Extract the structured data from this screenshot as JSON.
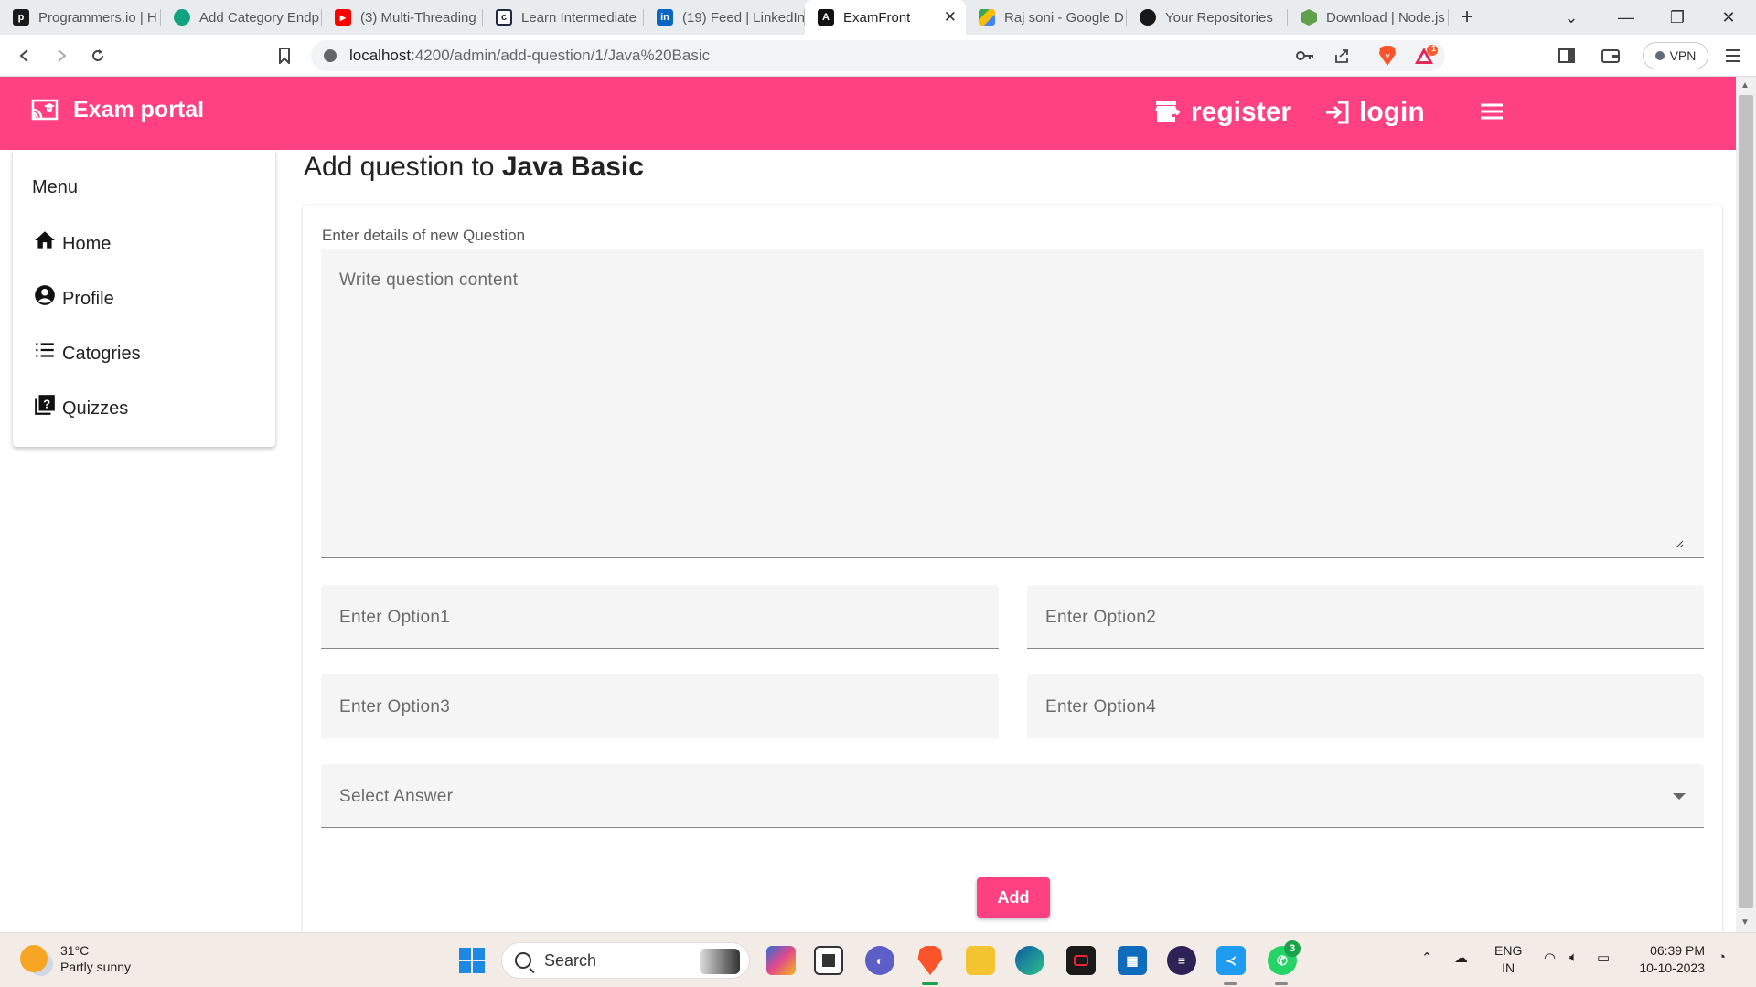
{
  "browser": {
    "tabs": [
      {
        "title": "Programmers.io | H",
        "fav": "p",
        "color": "#1a1a1a"
      },
      {
        "title": "Add Category Endp",
        "fav": "",
        "color": "#10a37f"
      },
      {
        "title": "(3) Multi-Threading",
        "fav": "",
        "color": "#ff0000"
      },
      {
        "title": "Learn Intermediate",
        "fav": "c",
        "color": "#1f2a44"
      },
      {
        "title": "(19) Feed | LinkedIn",
        "fav": "in",
        "color": "#0a66c2"
      },
      {
        "title": "ExamFront",
        "fav": "A",
        "color": "#111111"
      },
      {
        "title": "Raj soni - Google D",
        "fav": "",
        "color": "#34a853"
      },
      {
        "title": "Your Repositories",
        "fav": "",
        "color": "#181717"
      },
      {
        "title": "Download | Node.js",
        "fav": "",
        "color": "#5fa04e"
      }
    ],
    "active_tab_index": 5,
    "url_host": "localhost",
    "url_path": ":4200/admin/add-question/1/Java%20Basic",
    "vpn_label": "VPN",
    "badge_count": "1"
  },
  "header": {
    "brand": "Exam portal",
    "register": "register",
    "login": "login",
    "bg_color": "#ff4081"
  },
  "sidebar": {
    "title": "Menu",
    "items": [
      {
        "label": "Home",
        "icon": "home-icon"
      },
      {
        "label": "Profile",
        "icon": "account-circle-icon"
      },
      {
        "label": "Catogries",
        "icon": "list-icon"
      },
      {
        "label": "Quizzes",
        "icon": "quiz-icon"
      }
    ]
  },
  "main": {
    "title_prefix": "Add question to ",
    "title_quiz": "Java Basic",
    "form_label": "Enter details of new Question",
    "content_placeholder": "Write question content",
    "option1_placeholder": "Enter Option1",
    "option2_placeholder": "Enter Option2",
    "option3_placeholder": "Enter Option3",
    "option4_placeholder": "Enter Option4",
    "answer_placeholder": "Select Answer",
    "add_button": "Add"
  },
  "taskbar": {
    "temperature": "31°C",
    "weather": "Partly sunny",
    "search": "Search",
    "lang1": "ENG",
    "lang2": "IN",
    "time": "06:39 PM",
    "date": "10-10-2023",
    "whatsapp_badge": "3"
  }
}
